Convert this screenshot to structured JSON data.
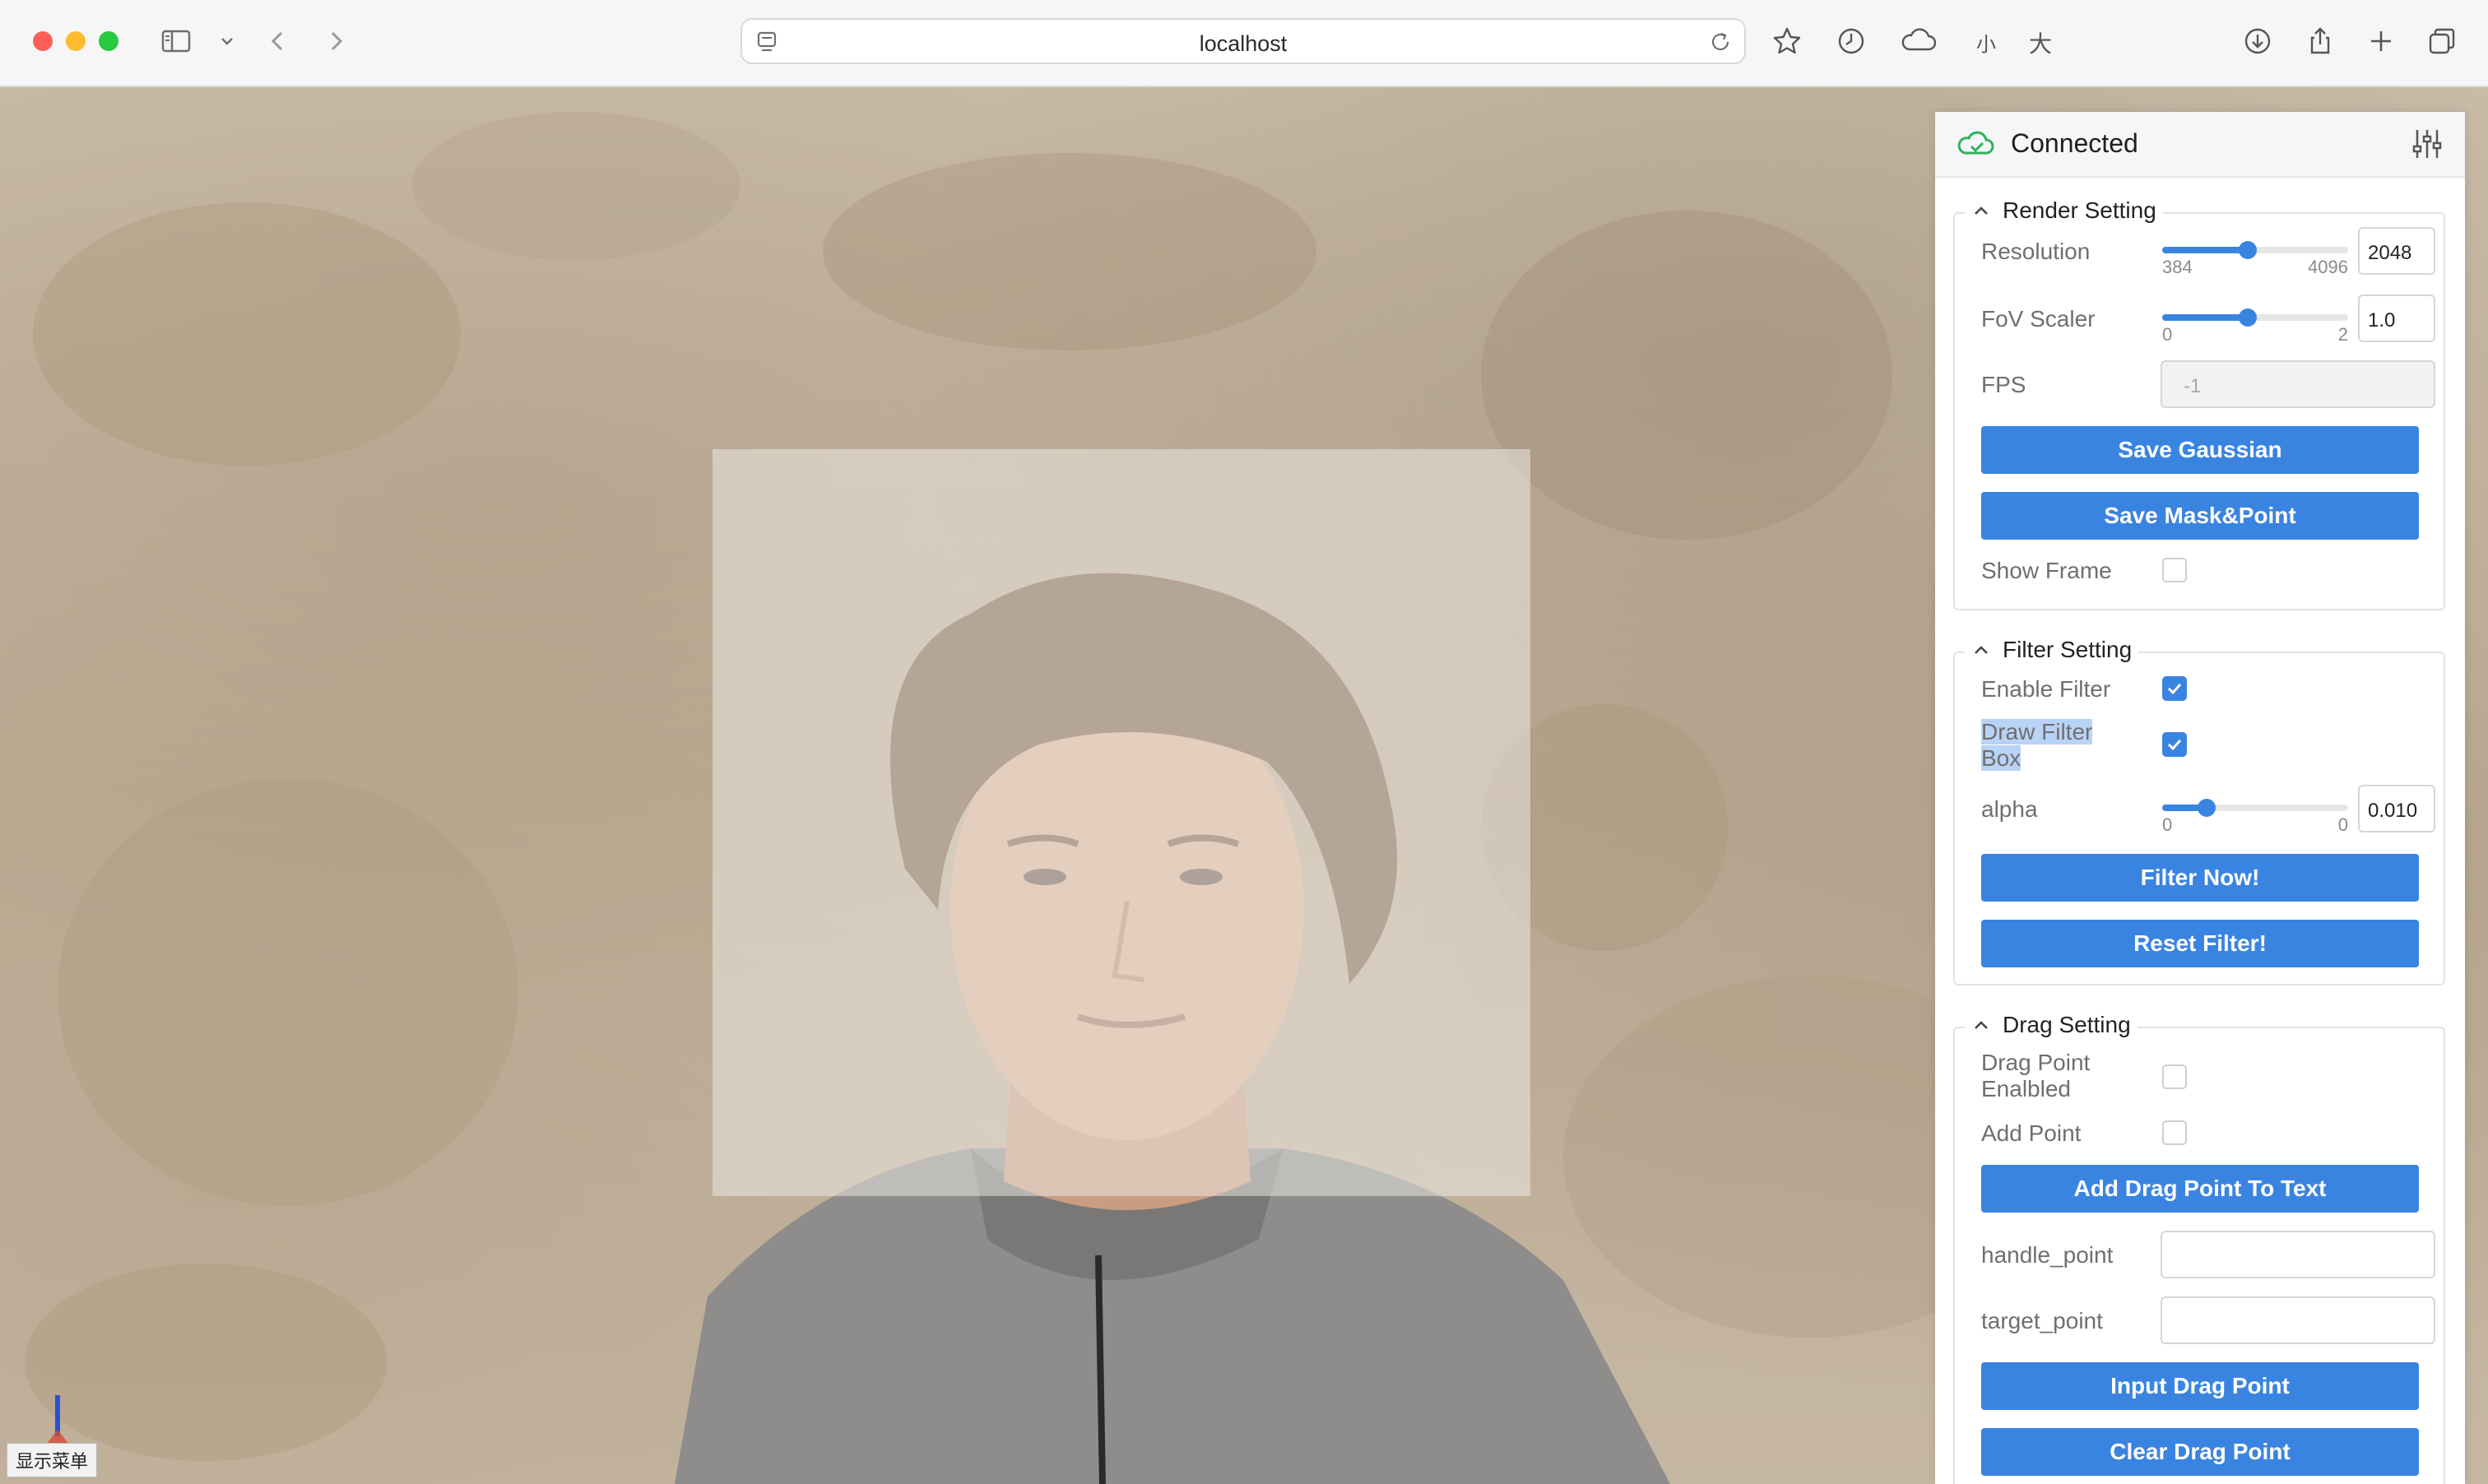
{
  "browser": {
    "url": "localhost",
    "cjk_small": "小",
    "cjk_large": "大"
  },
  "viewport": {
    "status_label": "显示菜单"
  },
  "panel": {
    "connection_status": "Connected",
    "render": {
      "title": "Render Setting",
      "resolution": {
        "label": "Resolution",
        "min": "384",
        "max": "4096",
        "value": "2048",
        "fraction": 0.46
      },
      "fov": {
        "label": "FoV Scaler",
        "min": "0",
        "max": "2",
        "value": "1.0",
        "fraction": 0.46
      },
      "fps": {
        "label": "FPS",
        "placeholder": "-1"
      },
      "save_gaussian": "Save Gaussian",
      "save_mask_point": "Save Mask&Point",
      "show_frame": {
        "label": "Show Frame",
        "checked": false
      }
    },
    "filter": {
      "title": "Filter Setting",
      "enable_filter": {
        "label": "Enable Filter",
        "checked": true
      },
      "draw_filter_box": {
        "label_line1": "Draw Filter",
        "label_line2": "Box",
        "checked": true
      },
      "alpha": {
        "label": "alpha",
        "min": "0",
        "max": "0",
        "value": "0.010",
        "fraction": 0.24
      },
      "filter_now": "Filter Now!",
      "reset_filter": "Reset Filter!"
    },
    "drag": {
      "title": "Drag Setting",
      "drag_point_enabled": {
        "label_line1": "Drag Point",
        "label_line2": "Enalbled",
        "checked": false
      },
      "add_point": {
        "label": "Add Point",
        "checked": false
      },
      "add_drag_point_to_text": "Add Drag Point To Text",
      "handle_point": {
        "label": "handle_point",
        "value": ""
      },
      "target_point": {
        "label": "target_point",
        "value": ""
      },
      "input_drag_point": "Input Drag Point",
      "clear_drag_point": "Clear Drag Point"
    }
  },
  "colors": {
    "accent": "#3a84e1",
    "connected_green": "#2fb35a",
    "selection": "#b9d3f6"
  }
}
